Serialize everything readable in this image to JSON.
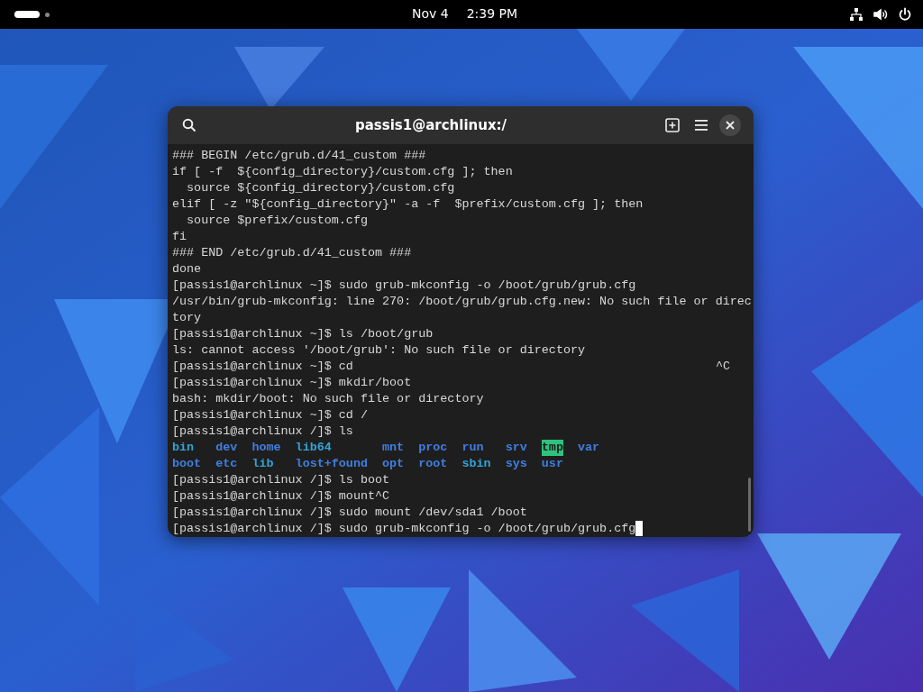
{
  "top_bar": {
    "date": "Nov 4",
    "time": "2:39 PM"
  },
  "terminal": {
    "title": "passis1@archlinux:/",
    "lines": [
      {
        "kind": "text",
        "text": "### BEGIN /etc/grub.d/41_custom ###"
      },
      {
        "kind": "text",
        "text": "if [ -f  ${config_directory}/custom.cfg ]; then"
      },
      {
        "kind": "text",
        "text": "  source ${config_directory}/custom.cfg"
      },
      {
        "kind": "text",
        "text": "elif [ -z \"${config_directory}\" -a -f  $prefix/custom.cfg ]; then"
      },
      {
        "kind": "text",
        "text": "  source $prefix/custom.cfg"
      },
      {
        "kind": "text",
        "text": "fi"
      },
      {
        "kind": "text",
        "text": "### END /etc/grub.d/41_custom ###"
      },
      {
        "kind": "text",
        "text": "done"
      },
      {
        "kind": "text",
        "text": "[passis1@archlinux ~]$ sudo grub-mkconfig -o /boot/grub/grub.cfg"
      },
      {
        "kind": "text",
        "text": "/usr/bin/grub-mkconfig: line 270: /boot/grub/grub.cfg.new: No such file or direc"
      },
      {
        "kind": "text",
        "text": "tory"
      },
      {
        "kind": "text",
        "text": "[passis1@archlinux ~]$ ls /boot/grub"
      },
      {
        "kind": "text",
        "text": "ls: cannot access '/boot/grub': No such file or directory"
      },
      {
        "kind": "text",
        "text": "[passis1@archlinux ~]$ cd",
        "right": "^C"
      },
      {
        "kind": "text",
        "text": "[passis1@archlinux ~]$ mkdir/boot"
      },
      {
        "kind": "text",
        "text": "bash: mkdir/boot: No such file or directory"
      },
      {
        "kind": "text",
        "text": "[passis1@archlinux ~]$ cd /"
      },
      {
        "kind": "text",
        "text": "[passis1@archlinux /]$ ls"
      },
      {
        "kind": "listing",
        "rows": [
          [
            {
              "name": "bin",
              "kind": "link"
            },
            {
              "name": "dev",
              "kind": "dir"
            },
            {
              "name": "home",
              "kind": "dir"
            },
            {
              "name": "lib64",
              "kind": "link"
            },
            {
              "name": "mnt",
              "kind": "dir"
            },
            {
              "name": "proc",
              "kind": "dir"
            },
            {
              "name": "run",
              "kind": "dir"
            },
            {
              "name": "srv",
              "kind": "dir"
            },
            {
              "name": "tmp",
              "kind": "sticky"
            },
            {
              "name": "var",
              "kind": "dir"
            }
          ],
          [
            {
              "name": "boot",
              "kind": "dir"
            },
            {
              "name": "etc",
              "kind": "dir"
            },
            {
              "name": "lib",
              "kind": "link"
            },
            {
              "name": "lost+found",
              "kind": "dir"
            },
            {
              "name": "opt",
              "kind": "dir"
            },
            {
              "name": "root",
              "kind": "dir"
            },
            {
              "name": "sbin",
              "kind": "link"
            },
            {
              "name": "sys",
              "kind": "dir"
            },
            {
              "name": "usr",
              "kind": "dir"
            }
          ]
        ]
      },
      {
        "kind": "text",
        "text": "[passis1@archlinux /]$ ls boot"
      },
      {
        "kind": "text",
        "text": "[passis1@archlinux /]$ mount^C"
      },
      {
        "kind": "text",
        "text": "[passis1@archlinux /]$ sudo mount /dev/sda1 /boot"
      },
      {
        "kind": "prompt",
        "text": "[passis1@archlinux /]$ sudo grub-mkconfig -o /boot/grub/grub.cfg"
      }
    ]
  }
}
